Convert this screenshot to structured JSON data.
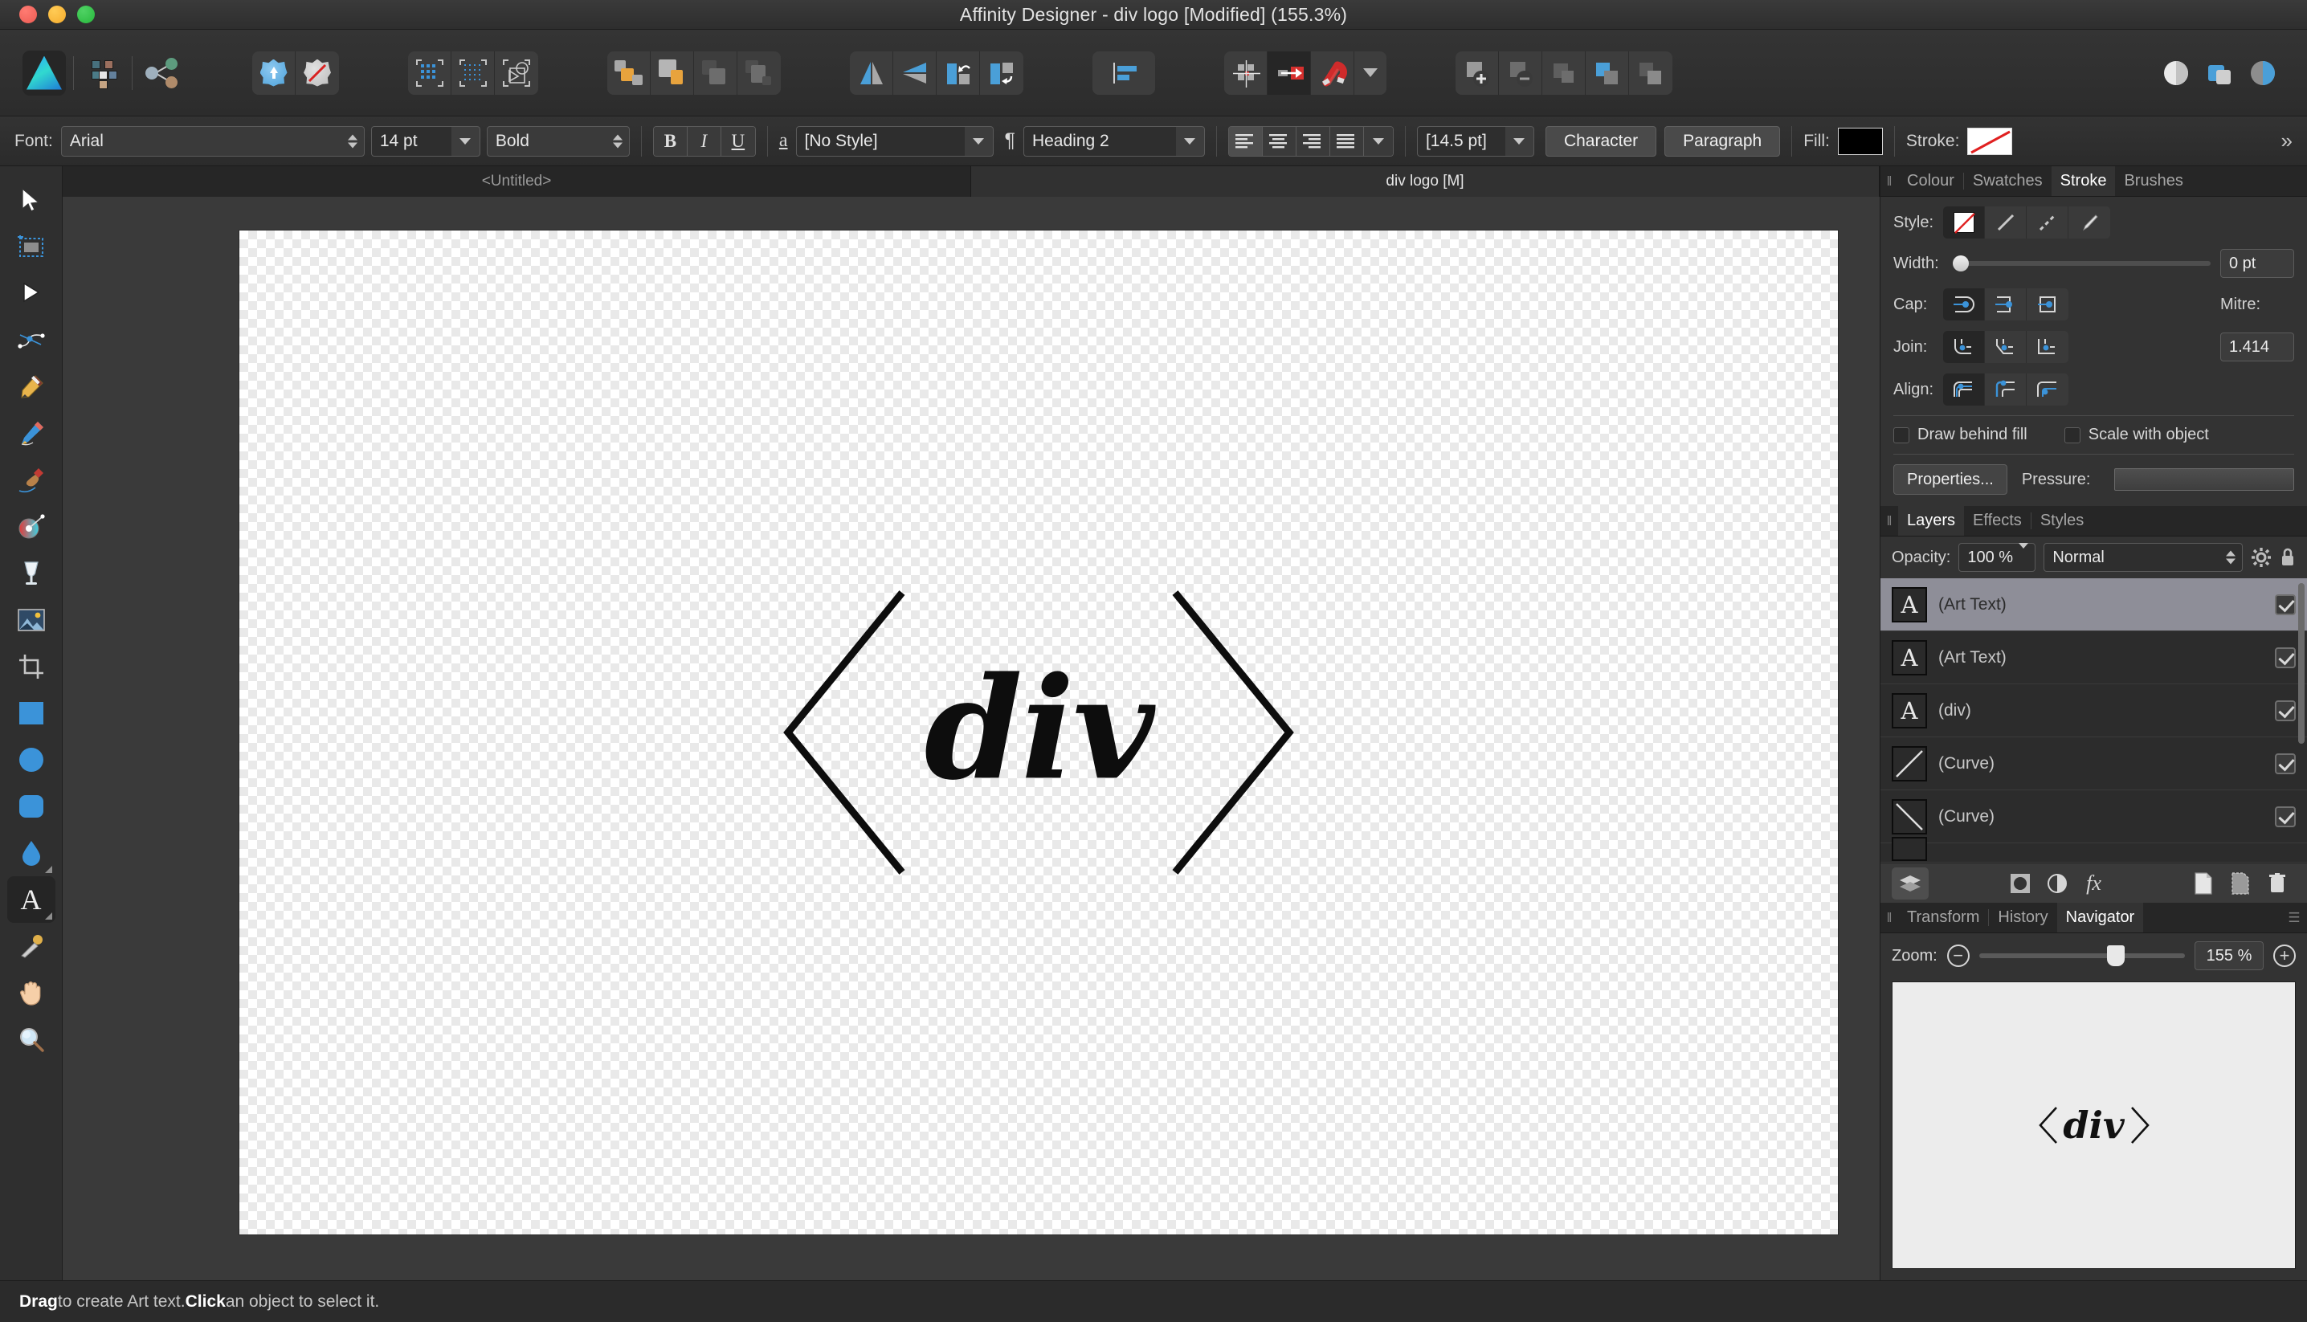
{
  "window": {
    "title": "Affinity Designer - div logo [Modified] (155.3%)",
    "traffic": {
      "close": "close-button",
      "minimize": "minimize-button",
      "maximize": "maximize-button"
    }
  },
  "toolbar": {
    "affinity_logo": "affinity-designer-logo",
    "persona_draw": "draw-persona",
    "persona_pixel": "pixel-persona",
    "persona_export": "export-persona",
    "share": "share-icon",
    "snapshot_add": "add-snapshot",
    "snapshot_remove": "remove-snapshot",
    "select_all": "select-all-pixels",
    "deselect": "deselect-pixels",
    "convert_shape": "convert-to-curves",
    "boolean_add": "boolean-add",
    "boolean_subtract": "boolean-subtract",
    "boolean_intersect": "boolean-intersect",
    "boolean_xor": "boolean-xor",
    "flip_horizontal": "flip-horizontal",
    "flip_vertical": "flip-vertical",
    "rotate_ccw": "rotate-counterclockwise",
    "rotate_cw": "rotate-clockwise",
    "align": "align-left",
    "grid": "show-grid",
    "snap_move": "snapping-move",
    "magnet": "snapping-magnet",
    "magnet_dropdown": "snapping-options",
    "group_add": "new-group",
    "group_remove": "ungroup",
    "group_lock": "lock-children",
    "group_dup": "duplicate-group",
    "group_misc": "group-options",
    "style_a": "appearance-circle",
    "style_b": "appearance-layers",
    "style_c": "appearance-blend"
  },
  "text_toolbar": {
    "font_label": "Font:",
    "font_family": "Arial",
    "font_size": "14 pt",
    "font_weight": "Bold",
    "bold": "B",
    "italic": "I",
    "underline": "U",
    "char_style_icon": "character-style-icon",
    "char_style": "[No Style]",
    "para_style_icon": "pilcrow-icon",
    "para_style": "Heading 2",
    "align_left": "align-left-icon",
    "align_center": "align-center-icon",
    "align_right": "align-right-icon",
    "align_justify": "align-justify-icon",
    "align_more": "align-more-icon",
    "leading": "[14.5 pt]",
    "character_button": "Character",
    "paragraph_button": "Paragraph",
    "fill_label": "Fill:",
    "fill_color": "#000000",
    "stroke_label": "Stroke:",
    "stroke_color": "none",
    "overflow": "»"
  },
  "tools": [
    {
      "name": "move-tool",
      "glyph": "➤",
      "active": false
    },
    {
      "name": "artboard-tool",
      "glyph": "",
      "active": false
    },
    {
      "name": "node-tool",
      "glyph": "▶",
      "active": false
    },
    {
      "name": "corner-tool",
      "glyph": "",
      "active": false
    },
    {
      "name": "pen-tool",
      "glyph": "✒",
      "active": false
    },
    {
      "name": "pencil-tool",
      "glyph": "✏",
      "active": false
    },
    {
      "name": "vector-brush-tool",
      "glyph": "🖌",
      "active": false
    },
    {
      "name": "colour-picker-wheel-tool",
      "glyph": "",
      "active": false
    },
    {
      "name": "fill-tool",
      "glyph": "",
      "active": false
    },
    {
      "name": "place-image-tool",
      "glyph": "",
      "active": false
    },
    {
      "name": "crop-tool",
      "glyph": "",
      "active": false
    },
    {
      "name": "rectangle-tool",
      "glyph": "",
      "active": false
    },
    {
      "name": "ellipse-tool",
      "glyph": "",
      "active": false
    },
    {
      "name": "rounded-rectangle-tool",
      "glyph": "",
      "active": false
    },
    {
      "name": "teardrop-tool",
      "glyph": "",
      "active": false
    },
    {
      "name": "artistic-text-tool",
      "glyph": "A",
      "active": true
    },
    {
      "name": "colour-picker-tool",
      "glyph": "",
      "active": false
    },
    {
      "name": "pan-tool",
      "glyph": "✋",
      "active": false
    },
    {
      "name": "zoom-tool",
      "glyph": "🔍",
      "active": false
    }
  ],
  "document_tabs": [
    {
      "label": "<Untitled>",
      "active": false
    },
    {
      "label": "div logo [M]",
      "active": true
    }
  ],
  "canvas": {
    "artwork_text": "div",
    "left_bracket": "left-angle-bracket",
    "right_bracket": "right-angle-bracket"
  },
  "right_panel": {
    "top_tabs": [
      {
        "label": "Colour",
        "active": false
      },
      {
        "label": "Swatches",
        "active": false
      },
      {
        "label": "Stroke",
        "active": true
      },
      {
        "label": "Brushes",
        "active": false
      }
    ],
    "stroke": {
      "style_label": "Style:",
      "style_options": [
        "none-stroke",
        "solid-stroke",
        "dashed-stroke",
        "brush-stroke"
      ],
      "style_selected": 0,
      "width_label": "Width:",
      "width_value": "0 pt",
      "cap_label": "Cap:",
      "cap_options": [
        "round-cap",
        "butt-cap",
        "square-cap"
      ],
      "cap_selected": 0,
      "join_label": "Join:",
      "join_options": [
        "round-join",
        "bevel-join",
        "mitre-join"
      ],
      "join_selected": 0,
      "align_label": "Align:",
      "align_options": [
        "align-center-stroke",
        "align-inside-stroke",
        "align-outside-stroke"
      ],
      "align_selected": 0,
      "mitre_label": "Mitre:",
      "mitre_value": "1.414",
      "draw_behind_label": "Draw behind fill",
      "draw_behind_checked": false,
      "scale_with_object_label": "Scale with object",
      "scale_with_object_checked": false,
      "properties_button": "Properties...",
      "pressure_label": "Pressure:"
    },
    "layers_tabs": [
      {
        "label": "Layers",
        "active": true
      },
      {
        "label": "Effects",
        "active": false
      },
      {
        "label": "Styles",
        "active": false
      }
    ],
    "layers": {
      "opacity_label": "Opacity:",
      "opacity_value": "100 %",
      "blend_mode": "Normal",
      "gear_icon": "layer-settings-gear-icon",
      "lock_icon": "lock-icon",
      "items": [
        {
          "name": "(Art Text)",
          "thumb": "A",
          "visible": true,
          "selected": true
        },
        {
          "name": "(Art Text)",
          "thumb": "A",
          "visible": true,
          "selected": false
        },
        {
          "name": "(div)",
          "thumb": "A",
          "visible": true,
          "selected": false
        },
        {
          "name": "(Curve)",
          "thumb": "/",
          "visible": true,
          "selected": false
        },
        {
          "name": "(Curve)",
          "thumb": "\\",
          "visible": true,
          "selected": false
        }
      ],
      "tools": [
        "layers-stack-icon",
        "mask-icon",
        "adjustment-icon",
        "fx-icon",
        "new-layer-icon",
        "new-pixel-layer-icon",
        "delete-layer-icon"
      ]
    },
    "bottom_tabs": [
      {
        "label": "Transform",
        "active": false
      },
      {
        "label": "History",
        "active": false
      },
      {
        "label": "Navigator",
        "active": true
      }
    ],
    "navigator": {
      "zoom_label": "Zoom:",
      "zoom_out_icon": "zoom-out-icon",
      "zoom_in_icon": "zoom-in-icon",
      "zoom_value": "155 %",
      "zoom_percent": 62,
      "preview_text": "div",
      "menu_icon": "panel-menu-icon"
    }
  },
  "statusbar": {
    "bold1": "Drag",
    "text1": " to create Art text. ",
    "bold2": "Click",
    "text2": " an object to select it."
  },
  "colors": {
    "accent_blue": "#4a9fd8",
    "selection_grey": "#8e8e98",
    "panel_bg": "#333333",
    "toolbar_bg": "#2e2e2e",
    "canvas_bg": "#3a3a3a",
    "orange": "#e8a33d",
    "red": "#d32a2a"
  }
}
